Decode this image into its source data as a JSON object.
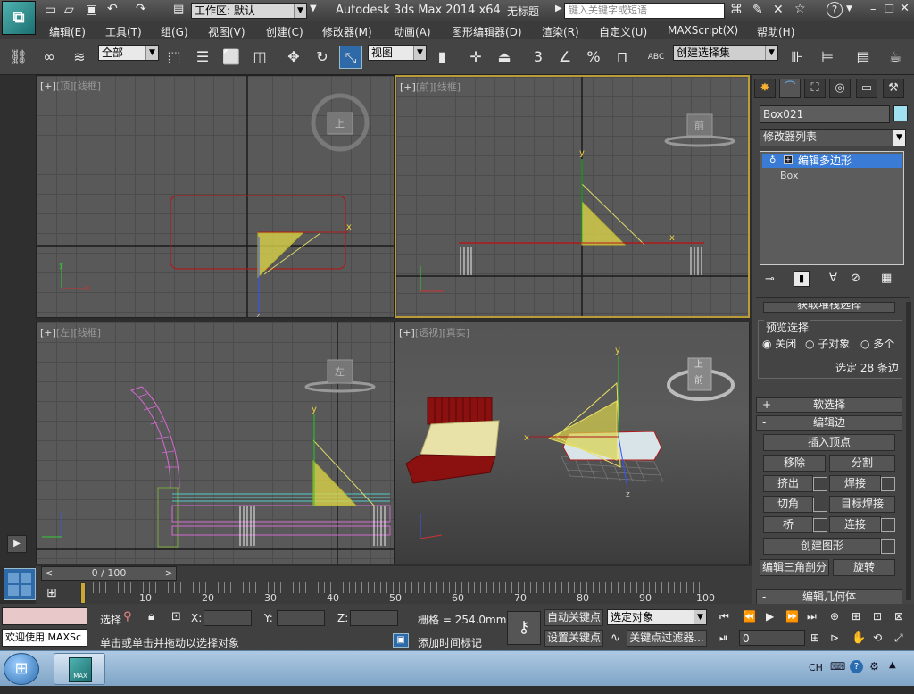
{
  "title_bar": {
    "workspace_label": "工作区: 默认",
    "app_title": "Autodesk 3ds Max  2014 x64",
    "doc_title": "无标题",
    "search_placeholder": "键入关键字或短语"
  },
  "menu": [
    "编辑(E)",
    "工具(T)",
    "组(G)",
    "视图(V)",
    "创建(C)",
    "修改器(M)",
    "动画(A)",
    "图形编辑器(D)",
    "渲染(R)",
    "自定义(U)",
    "MAXScript(X)",
    "帮助(H)"
  ],
  "toolbar": {
    "selection_filter": "全部",
    "ref_coord": "视图",
    "named_selection": "创建选择集",
    "snap_3": "3",
    "percent": "%",
    "abc": "ABC"
  },
  "viewports": {
    "top": {
      "plus": "[+]",
      "name": "[顶]",
      "shade": "[线框]",
      "cube": "上"
    },
    "front": {
      "plus": "[+]",
      "name": "[前]",
      "shade": "[线框]",
      "cube": "前"
    },
    "left": {
      "plus": "[+]",
      "name": "[左]",
      "shade": "[线框]",
      "cube": "左"
    },
    "persp": {
      "plus": "[+]",
      "name": "[透视]",
      "shade": "[真实]",
      "cube_top": "上",
      "cube_front": "前"
    }
  },
  "command_panel": {
    "object_name": "Box021",
    "modifier_list": "修改器列表",
    "stack": [
      "编辑多边形",
      "Box"
    ],
    "preview_selection": {
      "label": "预览选择",
      "options": [
        "关闭",
        "子对象",
        "多个"
      ],
      "selected_count": "选定 28 条边"
    },
    "clipped_rollout": "获取堆栈选择",
    "rollouts": {
      "soft_selection": {
        "sign": "+",
        "label": "软选择"
      },
      "edit_edges": {
        "sign": "-",
        "label": "编辑边"
      },
      "edit_geometry": {
        "sign": "-",
        "label": "编辑几何体"
      }
    },
    "buttons": {
      "insert_vertex": "插入顶点",
      "remove": "移除",
      "split": "分割",
      "extrude": "挤出",
      "weld": "焊接",
      "chamfer": "切角",
      "target_weld": "目标焊接",
      "bridge": "桥",
      "connect": "连接",
      "create_shape": "创建图形",
      "edit_tri": "编辑三角剖分",
      "rotate": "旋转"
    }
  },
  "timeline": {
    "range": "0 / 100",
    "ticks": [
      "10",
      "20",
      "30",
      "40",
      "50",
      "60",
      "70",
      "80",
      "90",
      "100"
    ],
    "nav_prev": "<",
    "nav_next": ">"
  },
  "status": {
    "maxscript_text": "欢迎使用 MAXSc",
    "selection_label": "选择",
    "x_label": "X:",
    "y_label": "Y:",
    "z_label": "Z:",
    "grid": "栅格 = 254.0mm",
    "prompt": "单击或单击并拖动以选择对象",
    "add_time_tag": "添加时间标记",
    "auto_key": "自动关键点",
    "set_key": "设置关键点",
    "key_mode": "选定对象",
    "key_filter": "关键点过滤器...",
    "frame_value": "0"
  },
  "taskbar": {
    "lang": "CH",
    "app_label": "MAX"
  },
  "colors": {
    "active_border": "#b99b38",
    "selection_red": "#b01a1a",
    "triangle_yellow": "#d9d24a",
    "stack_highlight": "#3a7bd5",
    "bed_red": "#8b1010",
    "mattress": "#e8e2a8"
  }
}
